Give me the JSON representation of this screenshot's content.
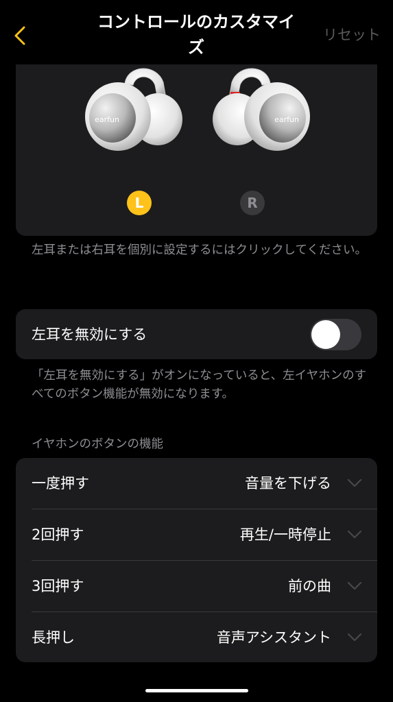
{
  "header": {
    "title": "コントロールのカスタマイズ",
    "reset_label": "リセット",
    "back_icon": "chevron-left-icon"
  },
  "earbuds": {
    "left_badge": "L",
    "right_badge": "R",
    "left_brand": "earfun",
    "right_brand": "earfun",
    "hint": "左耳または右耳を個別に設定するにはクリックしてください。"
  },
  "disable_ear": {
    "label": "左耳を無効にする",
    "enabled": false,
    "hint": "「左耳を無効にする」がオンになっていると、左イヤホンのすべてのボタン機能が無効になります。"
  },
  "functions": {
    "section_title": "イヤホンのボタンの機能",
    "rows": [
      {
        "label": "一度押す",
        "value": "音量を下げる"
      },
      {
        "label": "2回押す",
        "value": "再生/一時停止"
      },
      {
        "label": "3回押す",
        "value": "前の曲"
      },
      {
        "label": "長押し",
        "value": "音声アシスタント"
      }
    ]
  },
  "colors": {
    "accent": "#ffc21a",
    "background": "#000000",
    "card": "#1c1c1e",
    "secondary_text": "#8e8e93"
  }
}
